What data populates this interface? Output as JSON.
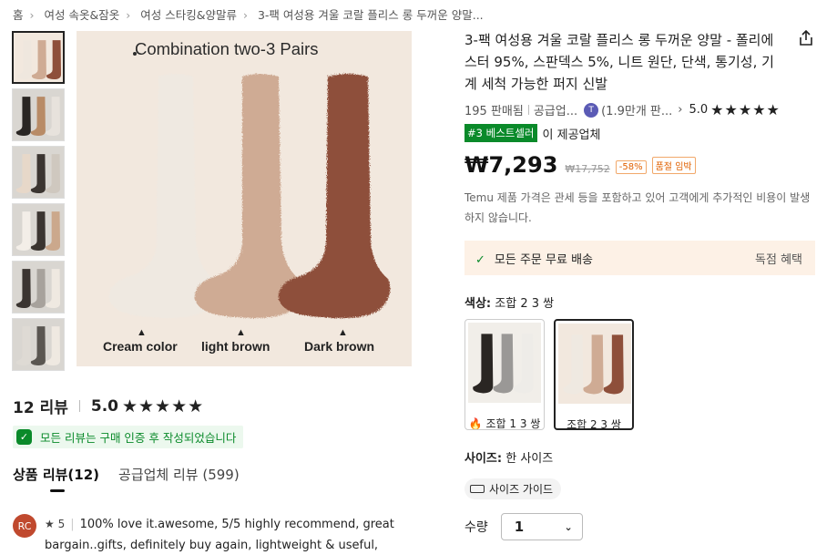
{
  "breadcrumb": [
    "홈",
    "여성 속옷&잠옷",
    "여성 스타킹&양말류",
    "3-팩 여성용 겨울 코랄 플리스 롱 두꺼운 양말..."
  ],
  "image": {
    "caption": "Combination two-3 Pairs",
    "sock_labels": [
      "Cream color",
      "light brown",
      "Dark brown"
    ],
    "sock_colors": [
      "#efe9e1",
      "#cfab94",
      "#8e4f3a"
    ]
  },
  "product": {
    "title": "3-팩 여성용 겨울 코랄 플리스 롱 두꺼운 양말 - 폴리에스터 95%, 스판덱스 5%, 니트 원단, 단색, 통기성, 기계 세척 가능한 퍼지 신발",
    "sold": "195 판매됨",
    "supplier": "공급업...",
    "supplier_logo": "T",
    "followers": "(1.9만개 판...",
    "rating": "5.0",
    "stars": "★★★★★",
    "best_badge": "#3 베스트셀러",
    "best_text": "이 제공업체",
    "price": "₩7,293",
    "old_price": "₩17,752",
    "discount": "-58%",
    "stock_tag": "품절 임박",
    "tax_note": "Temu 제품 가격은 관세 등을 포함하고 있어 고객에게 추가적인 비용이 발생하지 않습니다.",
    "shipping": "모든 주문 무료 배송",
    "shipping_perk": "독점 혜택",
    "variant_label": "색상:",
    "variant_value": "조합 2 3 쌍",
    "variants": [
      {
        "label": "조합 1 3 쌍",
        "hot": true,
        "colors": [
          "#2a2623",
          "#9a9896",
          "#eeece8"
        ]
      },
      {
        "label": "조합 2 3 쌍",
        "hot": false,
        "colors": [
          "#efe9e1",
          "#cfab94",
          "#8e4f3a"
        ]
      }
    ],
    "size_label": "사이즈:",
    "size_value": "한 사이즈",
    "size_guide": "사이즈 가이드",
    "qty_label": "수량",
    "qty_value": "1"
  },
  "reviews": {
    "count": "12 리뷰",
    "rating": "5.0",
    "stars": "★★★★★",
    "verified": "모든 리뷰는 구매 인증 후 작성되었습니다",
    "tabs": [
      "상품 리뷰(12)",
      "공급업체 리뷰 (599)"
    ],
    "first": {
      "initials": "RC",
      "rating": "★ 5",
      "text": "100% love it.awesome, 5/5 highly recommend, great bargain..gifts, definitely buy again, lightweight & useful, comfy and"
    }
  },
  "thumb_colors": [
    [
      "#efe7de",
      "#cfab94",
      "#8e4f3a"
    ],
    [
      "#2a2623",
      "#b88b66",
      "#e7e2dc"
    ],
    [
      "#e7d8c9",
      "#3b3531",
      "#cfc8bf"
    ],
    [
      "#f3eee8",
      "#3b3531",
      "#cba88c"
    ],
    [
      "#3b3531",
      "#a7a29c",
      "#efe9e1"
    ],
    [
      "#dedad4",
      "#5a5651",
      "#efe9e1"
    ]
  ]
}
